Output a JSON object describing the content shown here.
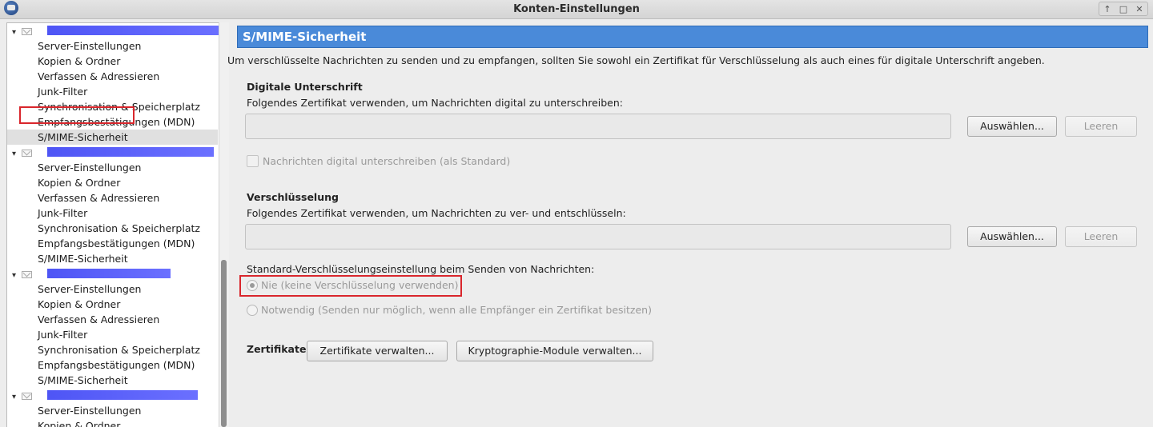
{
  "window": {
    "title": "Konten-Einstellungen",
    "controls": [
      "↑",
      "□",
      "✕"
    ]
  },
  "sidebar": {
    "accounts": [
      {
        "expanded": true,
        "children": [
          "Server-Einstellungen",
          "Kopien & Ordner",
          "Verfassen & Adressieren",
          "Junk-Filter",
          "Synchronisation & Speicherplatz",
          "Empfangsbestätigungen (MDN)",
          "S/MIME-Sicherheit"
        ]
      },
      {
        "expanded": true,
        "children": [
          "Server-Einstellungen",
          "Kopien & Ordner",
          "Verfassen & Adressieren",
          "Junk-Filter",
          "Synchronisation & Speicherplatz",
          "Empfangsbestätigungen (MDN)",
          "S/MIME-Sicherheit"
        ]
      },
      {
        "expanded": true,
        "children": [
          "Server-Einstellungen",
          "Kopien & Ordner",
          "Verfassen & Adressieren",
          "Junk-Filter",
          "Synchronisation & Speicherplatz",
          "Empfangsbestätigungen (MDN)",
          "S/MIME-Sicherheit"
        ]
      },
      {
        "expanded": true,
        "children": [
          "Server-Einstellungen",
          "Kopien & Ordner"
        ]
      }
    ],
    "selected": "S/MIME-Sicherheit"
  },
  "panel": {
    "header": "S/MIME-Sicherheit",
    "intro": "Um verschlüsselte Nachrichten zu senden und zu empfangen, sollten Sie sowohl ein Zertifikat für Verschlüsselung als auch eines für digitale Unterschrift angeben.",
    "signing": {
      "title": "Digitale Unterschrift",
      "description": "Folgendes Zertifikat verwenden, um Nachrichten digital zu unterschreiben:",
      "field_value": "",
      "select_label": "Auswählen...",
      "clear_label": "Leeren",
      "checkbox_label": "Nachrichten digital unterschreiben (als Standard)",
      "checkbox_checked": false
    },
    "encryption": {
      "title": "Verschlüsselung",
      "description": "Folgendes Zertifikat verwenden, um Nachrichten zu ver- und entschlüsseln:",
      "field_value": "",
      "select_label": "Auswählen...",
      "clear_label": "Leeren",
      "default_label": "Standard-Verschlüsselungseinstellung beim Senden von Nachrichten:",
      "options": [
        {
          "label": "Nie (keine Verschlüsselung verwenden)",
          "selected": true
        },
        {
          "label": "Notwendig (Senden nur möglich, wenn alle Empfänger ein Zertifikat besitzen)",
          "selected": false
        }
      ]
    },
    "certificates": {
      "title": "Zertifikate",
      "manage_label": "Zertifikate verwalten...",
      "modules_label": "Kryptographie-Module verwalten..."
    }
  },
  "colors": {
    "header_bg": "#4a8ad9",
    "highlight_box": "#d9262c",
    "redaction": "#4e55f5"
  }
}
